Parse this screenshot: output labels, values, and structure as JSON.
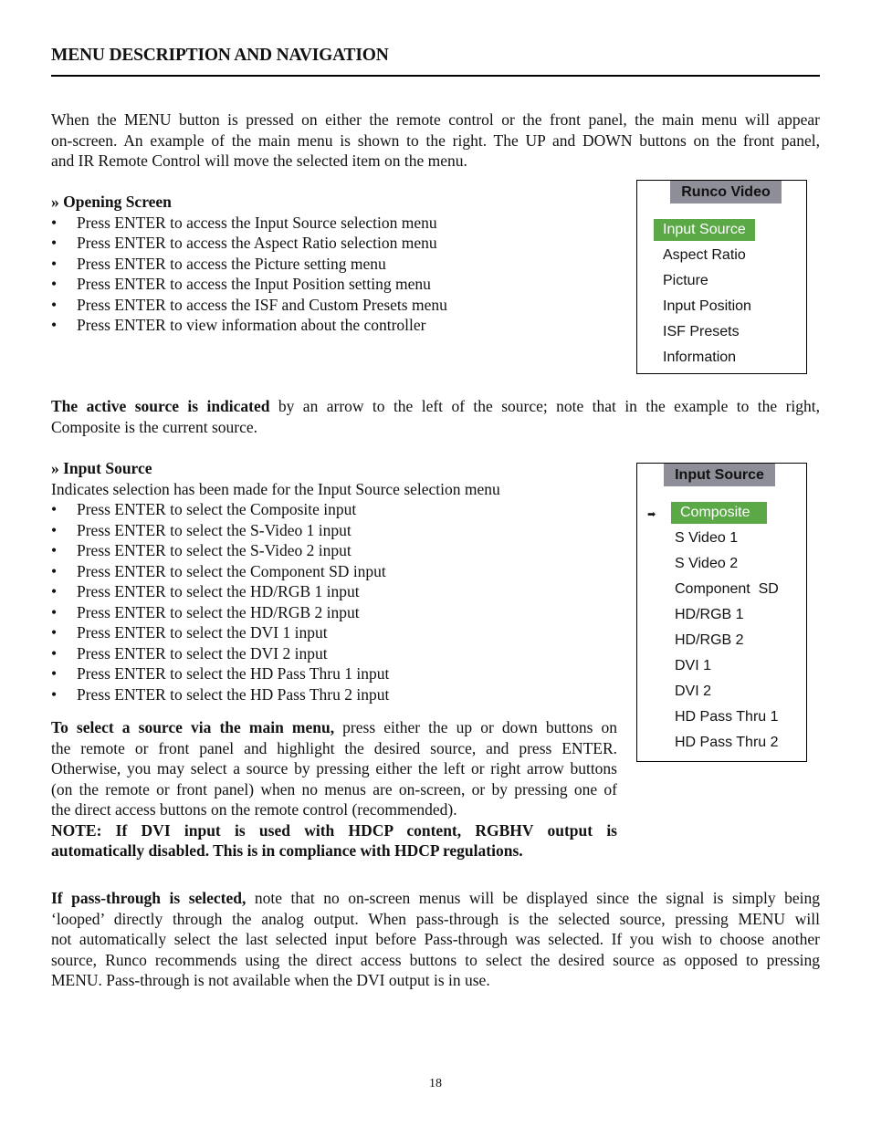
{
  "heading": "MENU DESCRIPTION AND NAVIGATION",
  "intro": [
    "When the MENU button is pressed on either the remote control or the front panel, the main menu will appear",
    "on-screen. An example of the main menu is shown to the right. The UP and DOWN buttons on the front panel,",
    "and IR Remote Control will move the selected item on the menu."
  ],
  "opening_screen": {
    "title": "» Opening Screen",
    "bullets": [
      "Press ENTER to access the Input Source selection menu",
      "Press ENTER to access the Aspect Ratio selection menu",
      "Press ENTER to access the Picture setting menu",
      "Press ENTER to access the Input Position setting menu",
      "Press ENTER to access the ISF and Custom Presets menu",
      "Press ENTER to view information about the controller"
    ]
  },
  "main_menu": {
    "title": "Runco Video",
    "items": [
      "Input Source",
      "Aspect Ratio",
      "Picture",
      "Input Position",
      "ISF Presets",
      "Information"
    ],
    "selected_index": 0,
    "highlight_color": "#5aa846",
    "header_color": "#8e8e98"
  },
  "active_source": {
    "bold": "The active source is indicated",
    "rest_line1": " by an arrow to the left of the source; note that in the example to the right,",
    "line2": "Composite is the current source."
  },
  "input_source_section": {
    "title": "» Input Source",
    "description": "Indicates selection has been made for the Input Source selection menu",
    "bullets": [
      "Press ENTER to select the Composite input",
      "Press ENTER to select the S-Video 1 input",
      "Press ENTER to select the S-Video 2 input",
      "Press ENTER to select the Component SD input",
      "Press ENTER to select the HD/RGB 1 input",
      "Press ENTER to select the HD/RGB 2 input",
      "Press ENTER to select the DVI 1 input",
      "Press ENTER to select the DVI 2 input",
      "Press ENTER to select the HD Pass Thru 1 input",
      "Press ENTER to select the HD Pass Thru 2 input"
    ]
  },
  "input_menu": {
    "title": "Input Source",
    "items": [
      "Composite",
      "S Video 1",
      "S Video 2",
      "Component  SD",
      "HD/RGB 1",
      "HD/RGB 2",
      "DVI 1",
      "DVI 2",
      "HD Pass Thru 1",
      "HD Pass Thru 2"
    ],
    "selected_index": 0,
    "active_index": 0,
    "arrow_glyph": "➡"
  },
  "select_source": {
    "bold": "To select a source via the main menu,",
    "rest_line1": " press either the up or down buttons on",
    "lines": [
      "the remote or front panel and highlight the desired source, and press ENTER.",
      "Otherwise, you may select a source by pressing either the left or right arrow buttons",
      "(on the remote or front panel) when no menus are on-screen, or by pressing one of",
      "the direct access buttons on the remote control (recommended)."
    ],
    "note_lines": [
      "NOTE: If DVI input is used with HDCP content, RGBHV output is",
      "automatically disabled. This is in compliance with HDCP regulations."
    ]
  },
  "pass_through": {
    "bold": "If pass-through is selected,",
    "rest_line1": " note that no on-screen menus will be displayed since the signal is simply being",
    "lines": [
      "‘looped’ directly through the analog output. When pass-through is the selected source, pressing MENU will",
      "not automatically select the last selected input before Pass-through was selected. If you wish to choose another",
      "source, Runco recommends using the direct access buttons to select the desired source as opposed to pressing",
      "MENU. Pass-through is not available when the DVI output is in use."
    ]
  },
  "page_number": "18"
}
